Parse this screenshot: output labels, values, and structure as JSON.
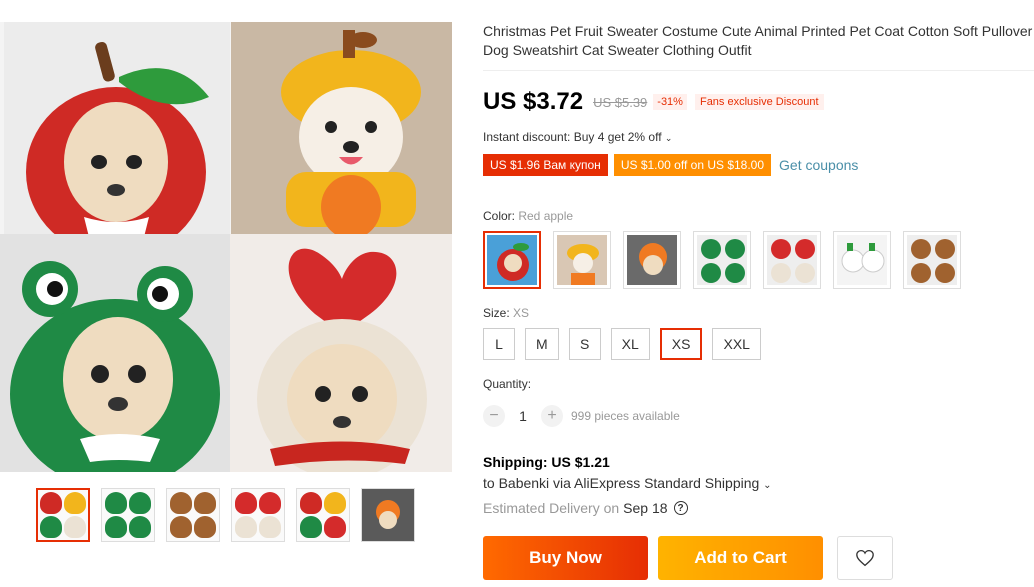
{
  "product": {
    "title": "Christmas Pet Fruit Sweater Costume Cute Animal Printed Pet Coat Cotton Soft Pullover Dog Sweatshirt Cat Sweater Clothing Outfit"
  },
  "price": {
    "current": "US $3.72",
    "original": "US $5.39",
    "discount_pct": "-31%",
    "fans_tag": "Fans exclusive Discount"
  },
  "instant_discount": "Instant discount: Buy 4 get 2% off",
  "coupons": {
    "coupon1": "US $1.96 Вам купон",
    "coupon2": "US $1.00 off on US $18.00",
    "get_coupons": "Get coupons"
  },
  "color": {
    "label": "Color: ",
    "selected": "Red apple",
    "options_count_note": ""
  },
  "size": {
    "label": "Size: ",
    "selected": "XS",
    "options": [
      "L",
      "M",
      "S",
      "XL",
      "XS",
      "XXL"
    ]
  },
  "quantity": {
    "label": "Quantity:",
    "value": "1",
    "minus": "−",
    "plus": "+",
    "available": "999 pieces available"
  },
  "shipping": {
    "title": "Shipping: US $1.21",
    "to": "to Babenki via AliExpress Standard Shipping",
    "delivery_label": "Estimated Delivery on",
    "delivery_date": "Sep 18"
  },
  "actions": {
    "buy_now": "Buy Now",
    "add_to_cart": "Add to Cart"
  },
  "colors": {
    "accent": "#e62e04",
    "orange": "#ff8f00",
    "link": "#4a8fa8"
  },
  "icons": {
    "wishlist": "heart-icon",
    "help": "question-circle-icon",
    "dropdown": "chevron-down-icon"
  }
}
